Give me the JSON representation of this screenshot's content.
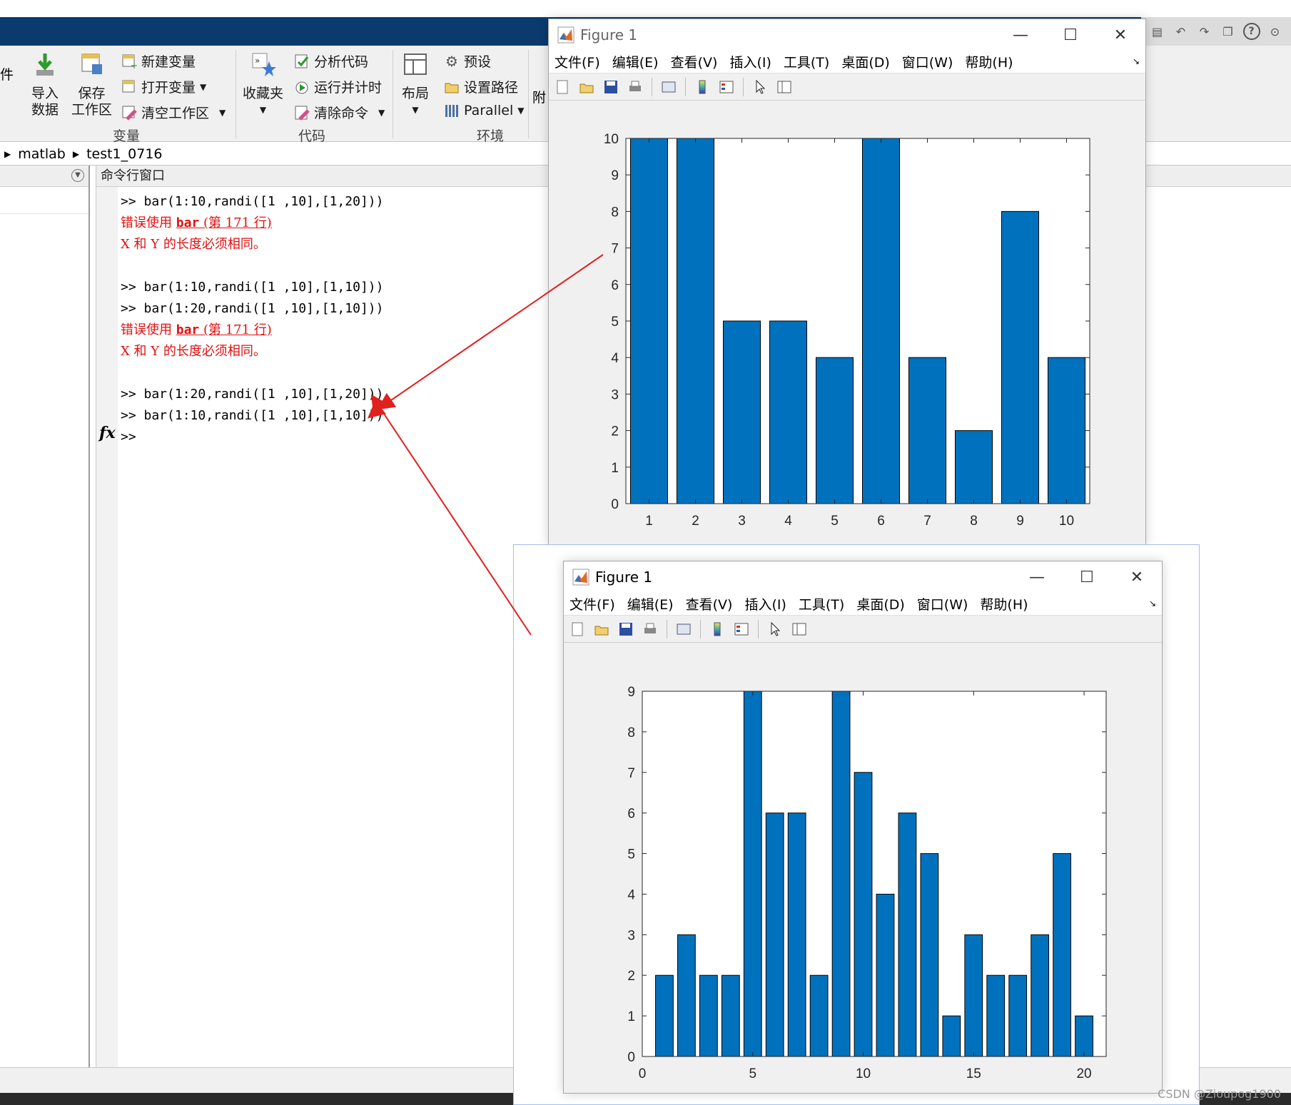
{
  "ribbon": {
    "file_fragment": "件",
    "variable_group": {
      "label": "变量",
      "import_data": [
        "导入",
        "数据"
      ],
      "save_workspace": [
        "保存",
        "工作区"
      ],
      "new_variable": "新建变量",
      "open_variable": "打开变量",
      "clear_workspace": "清空工作区"
    },
    "code_group": {
      "label": "代码",
      "favorites": "收藏夹",
      "analyze_code": "分析代码",
      "run_and_time": "运行并计时",
      "clear_commands": "清除命令"
    },
    "env_group": {
      "label": "环境",
      "layout": "布局",
      "preferences": "预设",
      "set_path": "设置路径",
      "parallel": "Parallel",
      "addons_fragment": "附"
    }
  },
  "address": {
    "segments": [
      "matlab",
      "test1_0716"
    ]
  },
  "command_window": {
    "title": "命令行窗口",
    "lines": [
      {
        "kind": "cmd",
        "text": ">> bar(1:10,randi([1 ,10],[1,20]))"
      },
      {
        "kind": "err",
        "prefix": "错误使用 ",
        "link": "bar",
        "suffix": " (第 171 行)"
      },
      {
        "kind": "err",
        "text": "X 和 Y 的长度必须相同。"
      },
      {
        "kind": "blank",
        "text": ""
      },
      {
        "kind": "cmd",
        "text": ">> bar(1:10,randi([1 ,10],[1,10]))"
      },
      {
        "kind": "cmd",
        "text": ">> bar(1:20,randi([1 ,10],[1,10]))"
      },
      {
        "kind": "err",
        "prefix": "错误使用 ",
        "link": "bar",
        "suffix": " (第 171 行)"
      },
      {
        "kind": "err",
        "text": "X 和 Y 的长度必须相同。"
      },
      {
        "kind": "blank",
        "text": ""
      },
      {
        "kind": "cmd",
        "text": ">> bar(1:20,randi([1 ,10],[1,20]))"
      },
      {
        "kind": "cmd",
        "text": ">> bar(1:10,randi([1 ,10],[1,10]))"
      },
      {
        "kind": "prompt",
        "text": ">>"
      }
    ],
    "fx_label": "fx"
  },
  "figures": [
    {
      "title": "Figure 1",
      "menu": [
        "文件(F)",
        "编辑(E)",
        "查看(V)",
        "插入(I)",
        "工具(T)",
        "桌面(D)",
        "窗口(W)",
        "帮助(H)"
      ],
      "win_controls": {
        "minimize": "—",
        "maximize": "☐",
        "close": "✕"
      },
      "chart_data": {
        "type": "bar",
        "x": [
          1,
          2,
          3,
          4,
          5,
          6,
          7,
          8,
          9,
          10
        ],
        "values": [
          10,
          10,
          5,
          5,
          4,
          10,
          4,
          2,
          8,
          4
        ],
        "xlim": [
          0.5,
          10.5
        ],
        "ylim": [
          0,
          10
        ],
        "xticks": [
          1,
          2,
          3,
          4,
          5,
          6,
          7,
          8,
          9,
          10
        ],
        "yticks": [
          0,
          1,
          2,
          3,
          4,
          5,
          6,
          7,
          8,
          9,
          10
        ],
        "bar_color": "#0072bd",
        "grid": false
      }
    },
    {
      "title": "Figure 1",
      "menu": [
        "文件(F)",
        "编辑(E)",
        "查看(V)",
        "插入(I)",
        "工具(T)",
        "桌面(D)",
        "窗口(W)",
        "帮助(H)"
      ],
      "win_controls": {
        "minimize": "—",
        "maximize": "☐",
        "close": "✕"
      },
      "chart_data": {
        "type": "bar",
        "x": [
          1,
          2,
          3,
          4,
          5,
          6,
          7,
          8,
          9,
          10,
          11,
          12,
          13,
          14,
          15,
          16,
          17,
          18,
          19,
          20
        ],
        "values": [
          2,
          3,
          2,
          2,
          9,
          6,
          6,
          2,
          9,
          7,
          4,
          6,
          5,
          1,
          3,
          2,
          2,
          3,
          5,
          1
        ],
        "xlim": [
          0,
          21
        ],
        "ylim": [
          0,
          9
        ],
        "xticks": [
          0,
          5,
          10,
          15,
          20
        ],
        "yticks": [
          0,
          1,
          2,
          3,
          4,
          5,
          6,
          7,
          8,
          9
        ],
        "bar_color": "#0072bd",
        "grid": false
      }
    }
  ],
  "colors": {
    "matlab_title_blue": "#0b3a6e",
    "error_red": "#e01010",
    "arrow_red": "#e0201c"
  },
  "watermark": "CSDN @Zioupog1900"
}
